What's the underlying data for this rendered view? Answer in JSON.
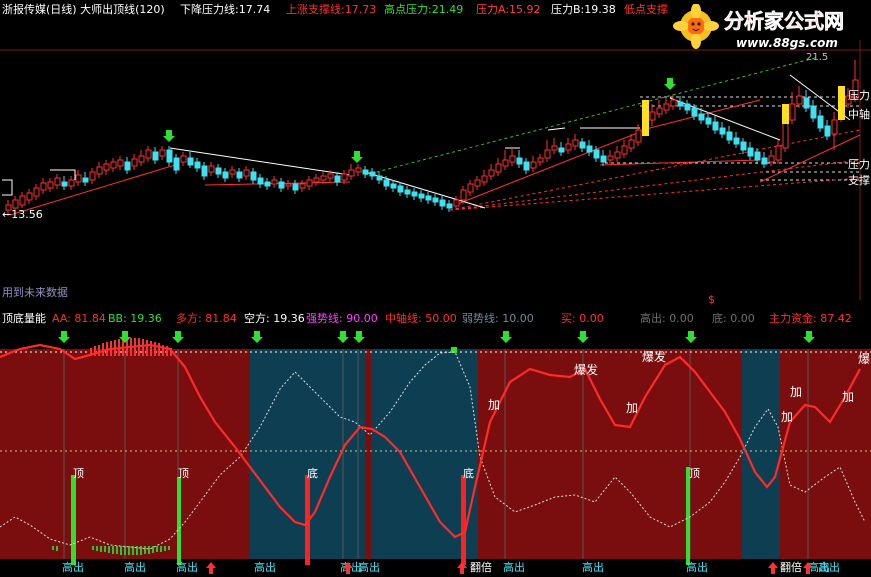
{
  "header": {
    "title": "浙报传媒(日线) 大师出顶线(120)",
    "items": [
      {
        "label": "下降压力线:",
        "value": "17.74",
        "color": "#ffffff"
      },
      {
        "label": "上涨支撑线:",
        "value": "17.73",
        "color": "#ff3030"
      },
      {
        "label": "高点压力:",
        "value": "21.49",
        "color": "#30e030"
      },
      {
        "label": "压力A:",
        "value": "15.92",
        "color": "#ff4040"
      },
      {
        "label": "压力B:",
        "value": "19.38",
        "color": "#ffffff"
      },
      {
        "label": "低点支撑",
        "value": "",
        "color": "#ff3030"
      }
    ]
  },
  "watermark": {
    "name": "分析家公式网",
    "url": "www.88gs.com"
  },
  "price_panel": {
    "low_label": "←13.56",
    "top_right_label": "21.5",
    "future_label": "用到未来数据",
    "right_labels": [
      "压力",
      "中轴",
      "压力",
      "支撑"
    ],
    "dollar_mark": "$"
  },
  "indicator_header": {
    "title": "顶底量能",
    "items": [
      {
        "label": "AA:",
        "value": "81.84",
        "color": "#ff3030"
      },
      {
        "label": "BB:",
        "value": "19.36",
        "color": "#30e030"
      },
      {
        "label": "多方:",
        "value": "81.84",
        "color": "#ff3030"
      },
      {
        "label": "空方:",
        "value": "19.36",
        "color": "#ffffff"
      },
      {
        "label": "强势线:",
        "value": "90.00",
        "color": "#ff40ff"
      },
      {
        "label": "中轴线:",
        "value": "50.00",
        "color": "#ff3030"
      },
      {
        "label": "弱势线:",
        "value": "10.00",
        "color": "#6a8aa0"
      },
      {
        "label": "买:",
        "value": "0.00",
        "color": "#ff3030"
      },
      {
        "label": "高出:",
        "value": "0.00",
        "color": "#707070"
      },
      {
        "label": "底:",
        "value": "0.00",
        "color": "#707070"
      },
      {
        "label": "主力资金:",
        "value": "87.42",
        "color": "#ff3030"
      }
    ]
  },
  "indicator_annotations": {
    "top": [
      "顶",
      "顶",
      "顶"
    ],
    "bottom": [
      "底",
      "底"
    ],
    "add": [
      "加",
      "加",
      "加",
      "加",
      "加"
    ],
    "burst": [
      "爆发",
      "爆发",
      "爆"
    ]
  },
  "bottom_labels": {
    "high_out": [
      "高出",
      "高出",
      "高出",
      "高出",
      "高出",
      "高出",
      "高出",
      "高出",
      "高出",
      "高出",
      "高出"
    ],
    "double": [
      "翻倍",
      "翻倍"
    ]
  },
  "colors": {
    "up_candle": "#ff3030",
    "down_candle": "#40e0f0",
    "bull_zone": "#7a0e0e",
    "bear_zone": "#0e3e52",
    "strong_line": "#ffffff",
    "grid": "#7a1010"
  }
}
